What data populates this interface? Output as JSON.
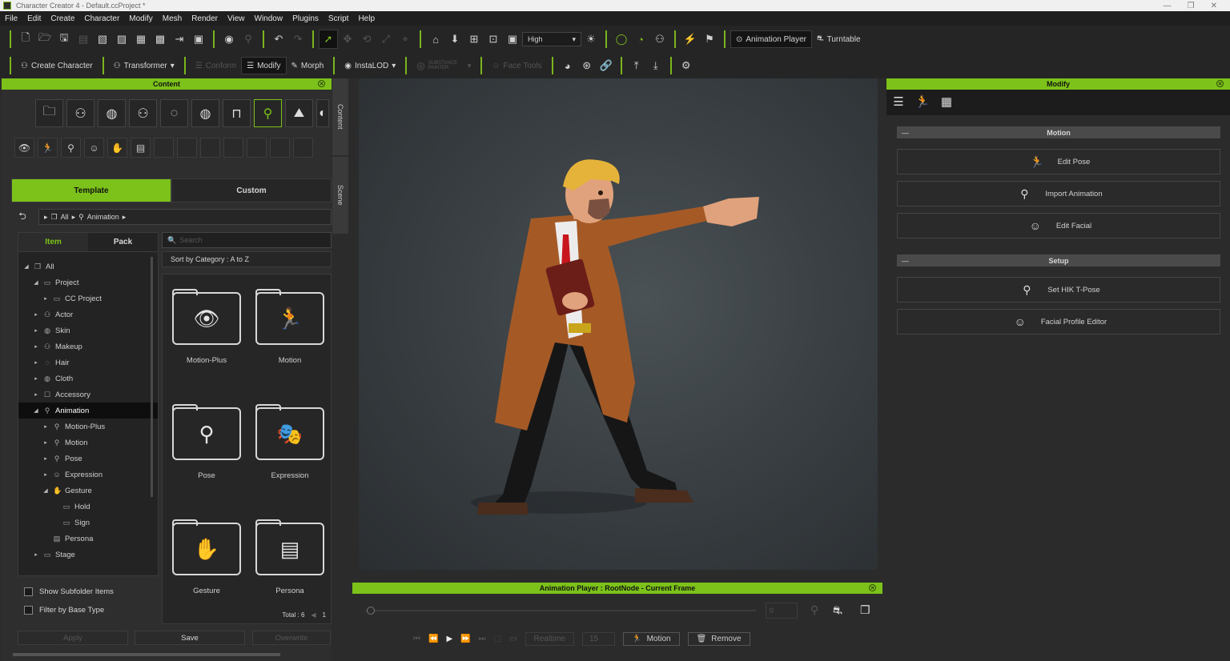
{
  "window": {
    "title": "Character Creator 4 - Default.ccProject *",
    "controls": [
      "—",
      "❐",
      "✕"
    ]
  },
  "menu": [
    "File",
    "Edit",
    "Create",
    "Character",
    "Modify",
    "Mesh",
    "Render",
    "View",
    "Window",
    "Plugins",
    "Script",
    "Help"
  ],
  "toolbar1": {
    "quality": "High",
    "animation_player": "Animation Player",
    "turntable": "Turntable"
  },
  "toolbar2": {
    "create_character": "Create Character",
    "transformer": "Transformer",
    "conform": "Conform",
    "modify": "Modify",
    "morph": "Morph",
    "instalod": "InstaLOD",
    "substance": "SUBSTANCE PAINTER",
    "face_tools": "Face Tools"
  },
  "content": {
    "title": "Content",
    "tabs": {
      "template": "Template",
      "custom": "Custom"
    },
    "breadcrumb": {
      "all": "All",
      "animation": "Animation"
    },
    "item_tab": "Item",
    "pack_tab": "Pack",
    "search_placeholder": "Search",
    "sort": "Sort by Category : A to Z",
    "tree": [
      {
        "label": "All",
        "level": 0,
        "arrow": "◢",
        "icon": "❐"
      },
      {
        "label": "Project",
        "level": 1,
        "arrow": "◢",
        "icon": "▭"
      },
      {
        "label": "CC Project",
        "level": 2,
        "arrow": "▸",
        "icon": "▭"
      },
      {
        "label": "Actor",
        "level": 1,
        "arrow": "▸",
        "icon": "⚇"
      },
      {
        "label": "Skin",
        "level": 1,
        "arrow": "▸",
        "icon": "◍"
      },
      {
        "label": "Makeup",
        "level": 1,
        "arrow": "▸",
        "icon": "⚇"
      },
      {
        "label": "Hair",
        "level": 1,
        "arrow": "▸",
        "icon": "◌"
      },
      {
        "label": "Cloth",
        "level": 1,
        "arrow": "▸",
        "icon": "◍"
      },
      {
        "label": "Accessory",
        "level": 1,
        "arrow": "▸",
        "icon": "☐"
      },
      {
        "label": "Animation",
        "level": 1,
        "arrow": "◢",
        "icon": "⚲"
      },
      {
        "label": "Motion-Plus",
        "level": 2,
        "arrow": "▸",
        "icon": "⚲"
      },
      {
        "label": "Motion",
        "level": 2,
        "arrow": "▸",
        "icon": "⚲"
      },
      {
        "label": "Pose",
        "level": 2,
        "arrow": "▸",
        "icon": "⚲"
      },
      {
        "label": "Expression",
        "level": 2,
        "arrow": "▸",
        "icon": "☺"
      },
      {
        "label": "Gesture",
        "level": 2,
        "arrow": "◢",
        "icon": "✋"
      },
      {
        "label": "Hold",
        "level": 3,
        "arrow": "",
        "icon": "▭"
      },
      {
        "label": "Sign",
        "level": 3,
        "arrow": "",
        "icon": "▭"
      },
      {
        "label": "Persona",
        "level": 2,
        "arrow": "",
        "icon": "▤"
      },
      {
        "label": "Stage",
        "level": 1,
        "arrow": "▸",
        "icon": "▭"
      }
    ],
    "folders": [
      {
        "label": "Motion-Plus",
        "glyph": "👁"
      },
      {
        "label": "Motion",
        "glyph": "🏃"
      },
      {
        "label": "Pose",
        "glyph": "⚲"
      },
      {
        "label": "Expression",
        "glyph": "🎭"
      },
      {
        "label": "Gesture",
        "glyph": "✋"
      },
      {
        "label": "Persona",
        "glyph": "▤"
      }
    ],
    "show_subfolder": "Show Subfolder Items",
    "filter_base": "Filter by Base Type",
    "total": "Total : 6",
    "page": "1",
    "apply": "Apply",
    "save": "Save",
    "overwrite": "Overwrite",
    "side_tabs": {
      "content": "Content",
      "scene": "Scene"
    }
  },
  "animation_player": {
    "title": "Animation Player : RootNode - Current Frame",
    "frame": "0",
    "realtime": "Realtime",
    "fps": "15",
    "motion": "Motion",
    "remove": "Remove"
  },
  "modify": {
    "title": "Modify",
    "motion_section": "Motion",
    "setup_section": "Setup",
    "buttons": {
      "edit_pose": "Edit Pose",
      "import_animation": "Import Animation",
      "edit_facial": "Edit Facial",
      "set_hik": "Set HIK T-Pose",
      "facial_profile": "Facial Profile Editor"
    }
  },
  "colors": {
    "accent": "#7cc21a",
    "panel": "#2b2b2b"
  }
}
